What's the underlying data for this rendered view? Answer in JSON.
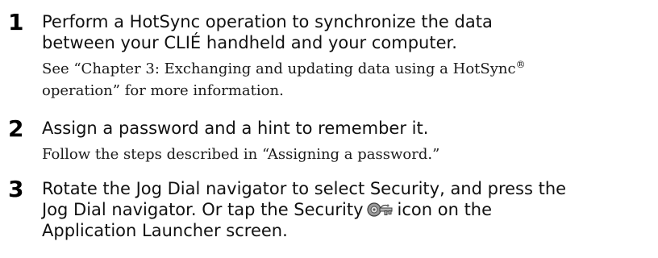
{
  "steps": [
    {
      "number": "1",
      "heading_lines": [
        "Perform a HotSync operation to synchronize the data",
        "between your CLIÉ handheld and your computer."
      ],
      "note_line1_prefix": "See “Chapter 3: Exchanging and updating data using a HotSync",
      "note_line1_sup": "®",
      "note_line2": "operation” for more information."
    },
    {
      "number": "2",
      "heading": "Assign a password and a hint to remember it.",
      "note": "Follow the steps described in “Assigning a password.”"
    },
    {
      "number": "3",
      "heading_line1": "Rotate the Jog Dial navigator to select Security, and press the",
      "heading_line2_before_icon": "Jog Dial navigator. Or tap the Security",
      "heading_line2_after_icon": "icon on the",
      "heading_line3": "Application Launcher screen.",
      "icon": "security-key-icon"
    }
  ]
}
